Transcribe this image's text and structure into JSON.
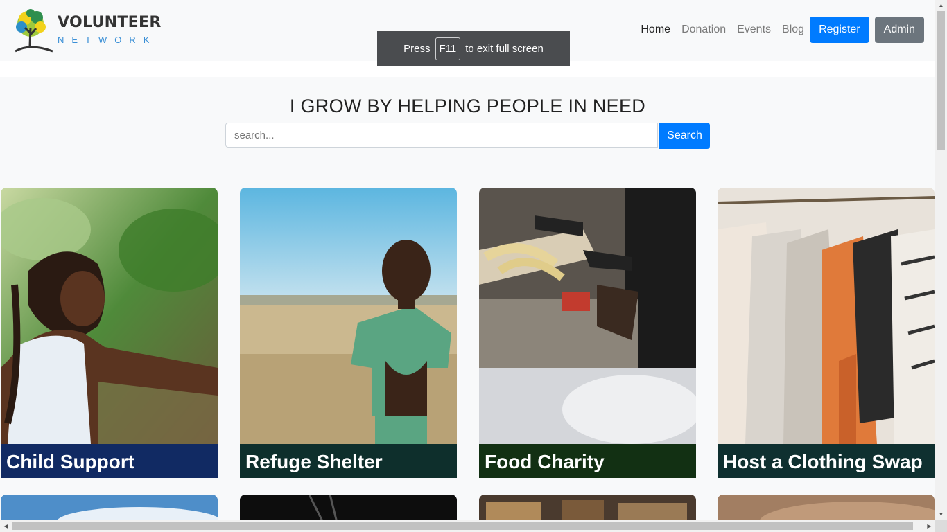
{
  "brand": {
    "title": "VOLUNTEER",
    "subtitle": "NETWORK"
  },
  "nav": {
    "links": [
      "Home",
      "Donation",
      "Events",
      "Blog"
    ],
    "register_label": "Register",
    "admin_label": "Admin"
  },
  "fullscreen_notice": {
    "before": "Press",
    "key": "F11",
    "after": "to exit full screen"
  },
  "hero": {
    "title": "I GROW BY HELPING PEOPLE IN NEED"
  },
  "search": {
    "placeholder": "search...",
    "button_label": "Search"
  },
  "cards": [
    {
      "title": "Child Support",
      "color": "#112a63"
    },
    {
      "title": "Refuge Shelter",
      "color": "#0e2f2c"
    },
    {
      "title": "Food Charity",
      "color": "#123013"
    },
    {
      "title": "Host a Clothing Swap",
      "color": "#0f3030"
    }
  ],
  "colors": {
    "primary": "#007bff",
    "secondary": "#6c757d"
  }
}
